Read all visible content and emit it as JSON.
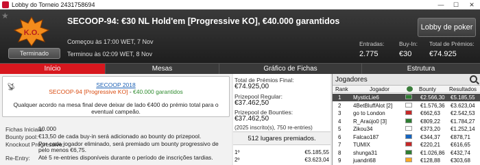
{
  "window": {
    "title": "Lobby do Torneio 2431758694",
    "minimize": "—",
    "maximize": "☐",
    "close": "✕"
  },
  "header": {
    "logo_text": "K.O.",
    "status": "Terminado",
    "tournament_name": "SECOOP-94: €30 NL Hold'em [Progressive KO], €40.000 garantidos",
    "started": "Começou às 17:00 WET, 7 Nov",
    "ended": "Terminou às 02:09 WET, 8 Nov",
    "lobby_button": "Lobby de poker",
    "stats": [
      {
        "label": "Entradas:",
        "value": "2.775"
      },
      {
        "label": "Buy-In:",
        "value": "€30"
      },
      {
        "label": "Total de Prémios:",
        "value": "€74.925"
      }
    ]
  },
  "tabs": [
    "Início",
    "Mesas",
    "Gráfico de Fichas",
    "Estrutura"
  ],
  "banner": {
    "link": "SECOOP 2018",
    "line2_a": "SECOOP-94 [Progressive KO]",
    "line2_sep": " - ",
    "line2_b": "€40.000 garantidos",
    "line3": "Qualquer acordo na mesa final deve deixar de lado €400 do prémio total para o eventual campeão."
  },
  "info": [
    {
      "label": "Fichas Iniciais:",
      "value": "10.000"
    },
    {
      "label": "Bounty pool:",
      "value": "€13,50 de cada buy-in será adicionado ao bounty do prizepool."
    },
    {
      "label": "Knockout Progressive:",
      "value": "Por cada jogador eliminado, será premiado um bounty progressivo de pelo menos €6,75."
    },
    {
      "label": "Re-Entry:",
      "value": "Até 5 re-entries disponíveis durante o período de inscrições tardias."
    }
  ],
  "prizes": {
    "total_label": "Total de Prémios Final:",
    "total_value": "€74.925,00",
    "regular_label": "Prizepool Regular:",
    "regular_value": "€37.462,50",
    "bounty_label": "Prizepool de Bounties:",
    "bounty_value": "€37.462,50",
    "entries_note": "(2025 inscrito(s), 750 re-entries)",
    "places_paid": "512 lugares premiados.",
    "rows": [
      {
        "rank": "1º",
        "amount": "€5.185,55"
      },
      {
        "rank": "2º",
        "amount": "€3.623,04"
      }
    ]
  },
  "players": {
    "title": "Jogadores",
    "columns": [
      "Rank",
      "Jogador",
      "Bounty",
      "Resultados"
    ],
    "rows": [
      {
        "rank": "1",
        "name": "MysticLie6",
        "flag": "#2e7d32",
        "bounty": "€2.566,30",
        "result": "€5.185,55"
      },
      {
        "rank": "2",
        "name": "4BetBluffAlot [2]",
        "flag": "#ffffff",
        "bounty": "€1.576,36",
        "result": "€3.623,04"
      },
      {
        "rank": "3",
        "name": "go to London",
        "flag": "#c62828",
        "bounty": "€662,63",
        "result": "€2.542,53"
      },
      {
        "rank": "4",
        "name": "R_Araújo0 [3]",
        "flag": "#2e7d32",
        "bounty": "€809,22",
        "result": "€1.784,27"
      },
      {
        "rank": "5",
        "name": "Zikou34",
        "flag": "#ffffff",
        "bounty": "€373,20",
        "result": "€1.252,14"
      },
      {
        "rank": "6",
        "name": "Falcao187",
        "flag": "#1565c0",
        "bounty": "€344,37",
        "result": "€878,71"
      },
      {
        "rank": "7",
        "name": "TUMIX",
        "flag": "#c62828",
        "bounty": "€220,21",
        "result": "€616,65"
      },
      {
        "rank": "8",
        "name": "shunga31",
        "flag": "#2e7d32",
        "bounty": "€1.026,86",
        "result": "€432,74"
      },
      {
        "rank": "9",
        "name": "juandri68",
        "flag": "#f9a825",
        "bounty": "€128,88",
        "result": "€303,68"
      }
    ]
  }
}
